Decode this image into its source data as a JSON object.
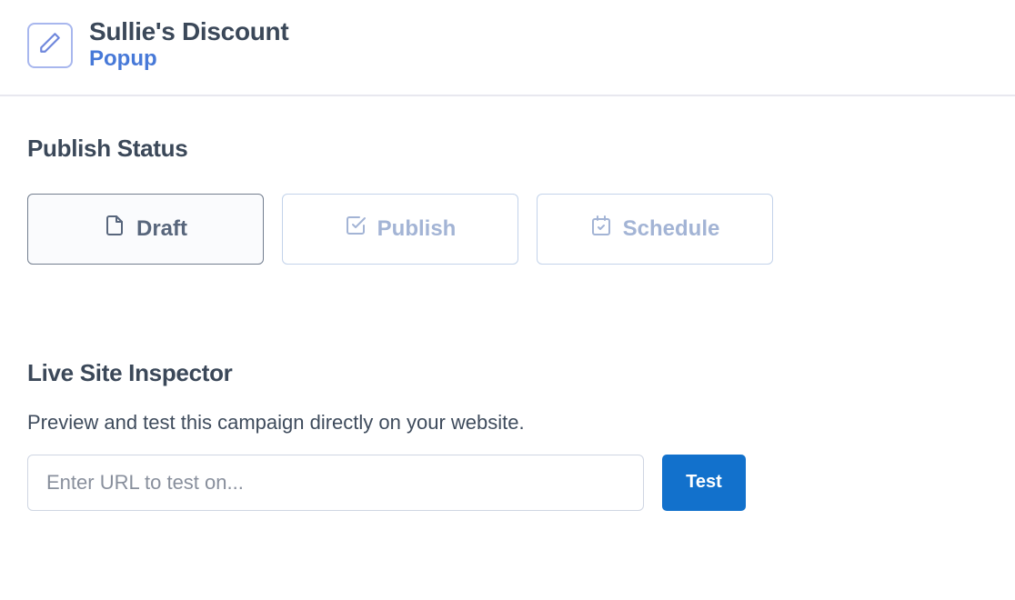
{
  "header": {
    "title": "Sullie's Discount",
    "type": "Popup"
  },
  "publish_status": {
    "heading": "Publish Status",
    "options": {
      "draft": "Draft",
      "publish": "Publish",
      "schedule": "Schedule"
    },
    "selected": "draft"
  },
  "inspector": {
    "heading": "Live Site Inspector",
    "description": "Preview and test this campaign directly on your website.",
    "url_value": "",
    "url_placeholder": "Enter URL to test on...",
    "test_label": "Test"
  }
}
